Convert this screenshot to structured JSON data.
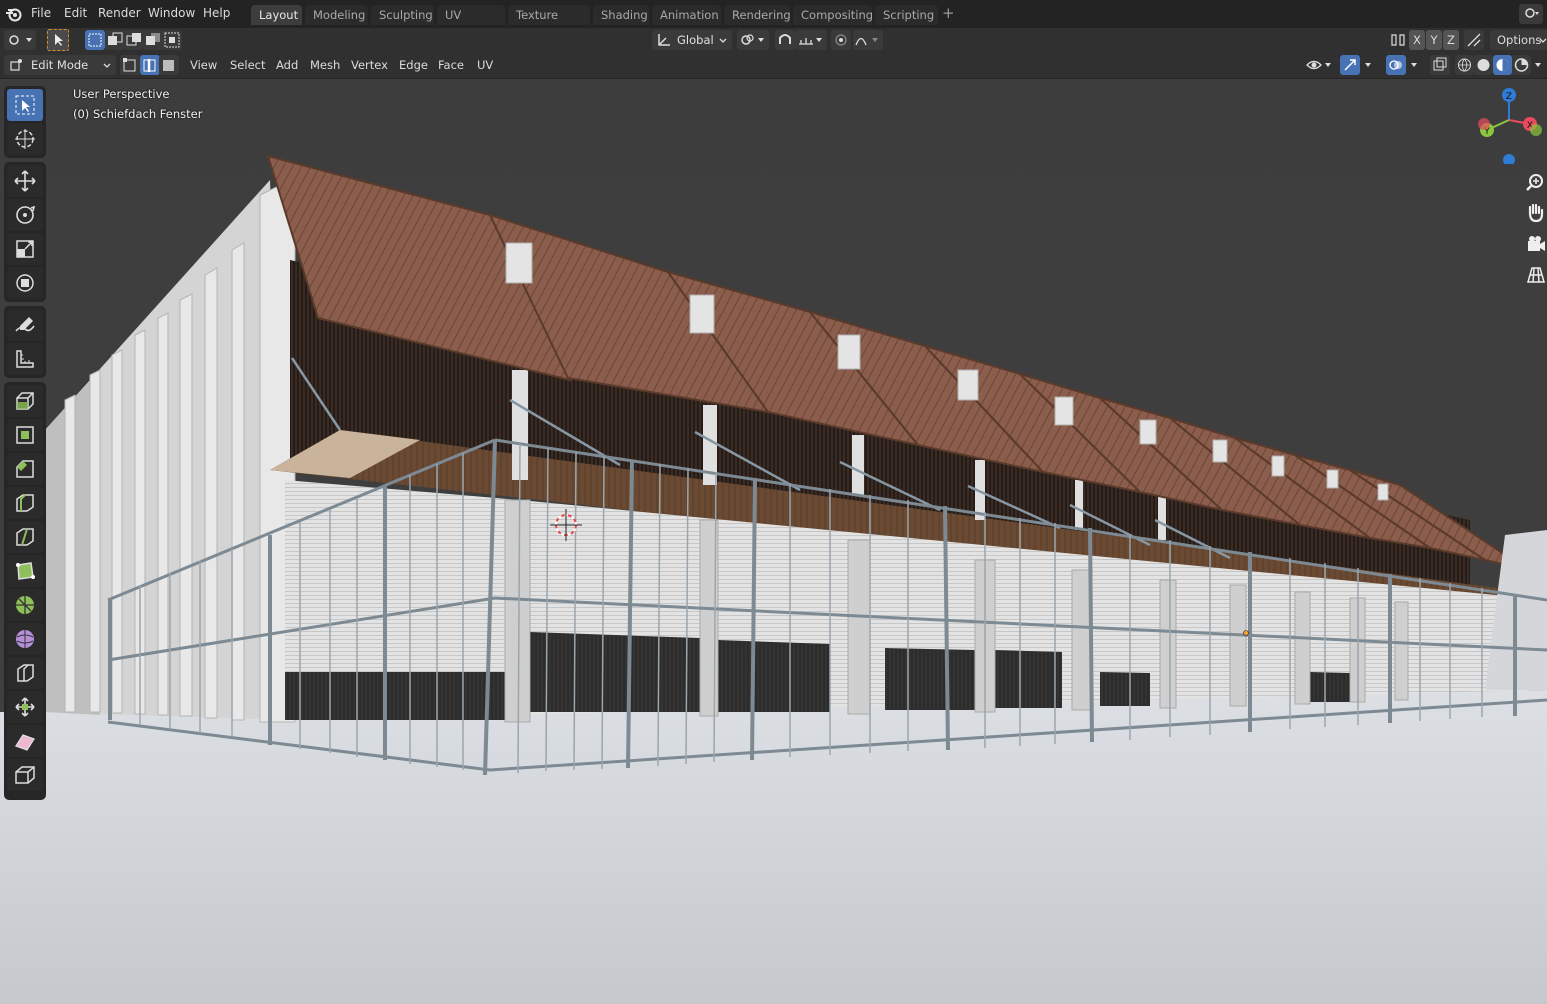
{
  "menubar": {
    "items": [
      "File",
      "Edit",
      "Render",
      "Window",
      "Help"
    ]
  },
  "workspaces": {
    "tabs": [
      "Layout",
      "Modeling",
      "Sculpting",
      "UV Editing",
      "Texture Paint",
      "Shading",
      "Animation",
      "Rendering",
      "Compositing",
      "Scripting"
    ],
    "active": "Layout",
    "add_label": "+"
  },
  "tool_header": {
    "transform_orientation": "Global",
    "axis_x": "X",
    "axis_y": "Y",
    "axis_z": "Z",
    "options_label": "Options"
  },
  "header": {
    "mode": "Edit Mode",
    "menus": [
      "View",
      "Select",
      "Add",
      "Mesh",
      "Vertex",
      "Edge",
      "Face",
      "UV"
    ]
  },
  "viewport": {
    "perspective_label": "User Perspective",
    "object_label": "(0) Schiefdach Fenster"
  },
  "gizmo": {
    "z_label": "Z",
    "x_label": "X",
    "y_label": "Y"
  },
  "colors": {
    "accent": "#4772b3",
    "axis_x": "#e84a5f",
    "axis_y": "#8cc63f",
    "axis_z": "#2e7cd6"
  }
}
